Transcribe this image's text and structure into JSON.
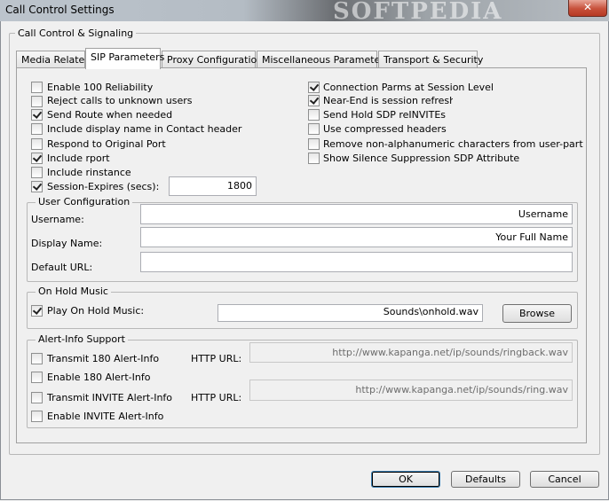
{
  "window": {
    "title": "Call Control Settings",
    "close_label": "✕",
    "watermark": "SOFTPEDIA"
  },
  "outer_group": {
    "label": "Call Control & Signaling"
  },
  "tabs": [
    {
      "label": "Media Related"
    },
    {
      "label": "SIP Parameters",
      "active": true
    },
    {
      "label": "Proxy Configuration"
    },
    {
      "label": "Miscellaneous Parameters"
    },
    {
      "label": "Transport & Security"
    }
  ],
  "left_options": [
    {
      "label": "Enable 100 Reliability",
      "checked": false
    },
    {
      "label": "Reject calls to unknown users",
      "checked": false
    },
    {
      "label": "Send Route when needed",
      "checked": true
    },
    {
      "label": "Include display name in Contact header",
      "checked": false
    },
    {
      "label": "Respond to Original Port",
      "checked": false
    },
    {
      "label": "Include rport",
      "checked": true
    },
    {
      "label": "Include rinstance",
      "checked": false
    },
    {
      "label": "Session-Expires (secs):",
      "checked": true
    }
  ],
  "session_expires": {
    "value": "1800"
  },
  "right_options": [
    {
      "label": "Connection Parms at Session Level",
      "checked": true
    },
    {
      "label": "Near-End is session refresher",
      "checked": true
    },
    {
      "label": "Send Hold SDP reINVITEs",
      "checked": false
    },
    {
      "label": "Use compressed headers",
      "checked": false
    },
    {
      "label": "Remove non-alphanumeric characters from user-part",
      "checked": false
    },
    {
      "label": "Show Silence Suppression SDP Attribute",
      "checked": false
    }
  ],
  "user_config": {
    "label": "User Configuration",
    "username_label": "Username:",
    "username_value": "Username",
    "display_name_label": "Display Name:",
    "display_name_value": "Your Full Name",
    "default_url_label": "Default URL:",
    "default_url_value": ""
  },
  "on_hold": {
    "label": "On Hold Music",
    "play_label": "Play On Hold Music:",
    "play_checked": true,
    "file_value": "Sounds\\onhold.wav",
    "browse_label": "Browse"
  },
  "alert_info": {
    "label": "Alert-Info Support",
    "transmit180_label": "Transmit 180 Alert-Info",
    "transmit180_checked": false,
    "enable180_label": "Enable 180 Alert-Info",
    "enable180_checked": false,
    "transmit_invite_label": "Transmit INVITE Alert-Info",
    "transmit_invite_checked": false,
    "enable_invite_label": "Enable INVITE Alert-Info",
    "enable_invite_checked": false,
    "http_url_label_1": "HTTP URL:",
    "http_url_value_1": "http://www.kapanga.net/ip/sounds/ringback.wav",
    "http_url_label_2": "HTTP URL:",
    "http_url_value_2": "http://www.kapanga.net/ip/sounds/ring.wav"
  },
  "buttons": {
    "ok": "OK",
    "defaults": "Defaults",
    "cancel": "Cancel"
  }
}
